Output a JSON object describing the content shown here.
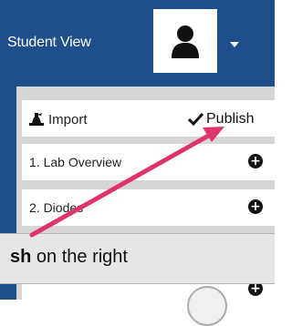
{
  "header": {
    "title": "Student View",
    "avatar_icon": "user-silhouette-icon",
    "menu_icon": "caret-down-icon",
    "bg_color": "#1f4f8a"
  },
  "toolbar": {
    "import_label": "Import",
    "import_icon": "stamp-icon",
    "publish_label": "Publish",
    "publish_icon": "checkmark-icon"
  },
  "list": {
    "items": [
      {
        "label": "1. Lab Overview",
        "action_icon": "plus-circle-icon"
      },
      {
        "label": "2. Diodes",
        "action_icon": "plus-circle-icon"
      },
      {
        "label": "",
        "action_icon": "plus-circle-icon"
      }
    ]
  },
  "callout": {
    "emphasis": "sh",
    "rest": " on the right"
  },
  "annotation": {
    "arrow_color": "#e0336e"
  }
}
